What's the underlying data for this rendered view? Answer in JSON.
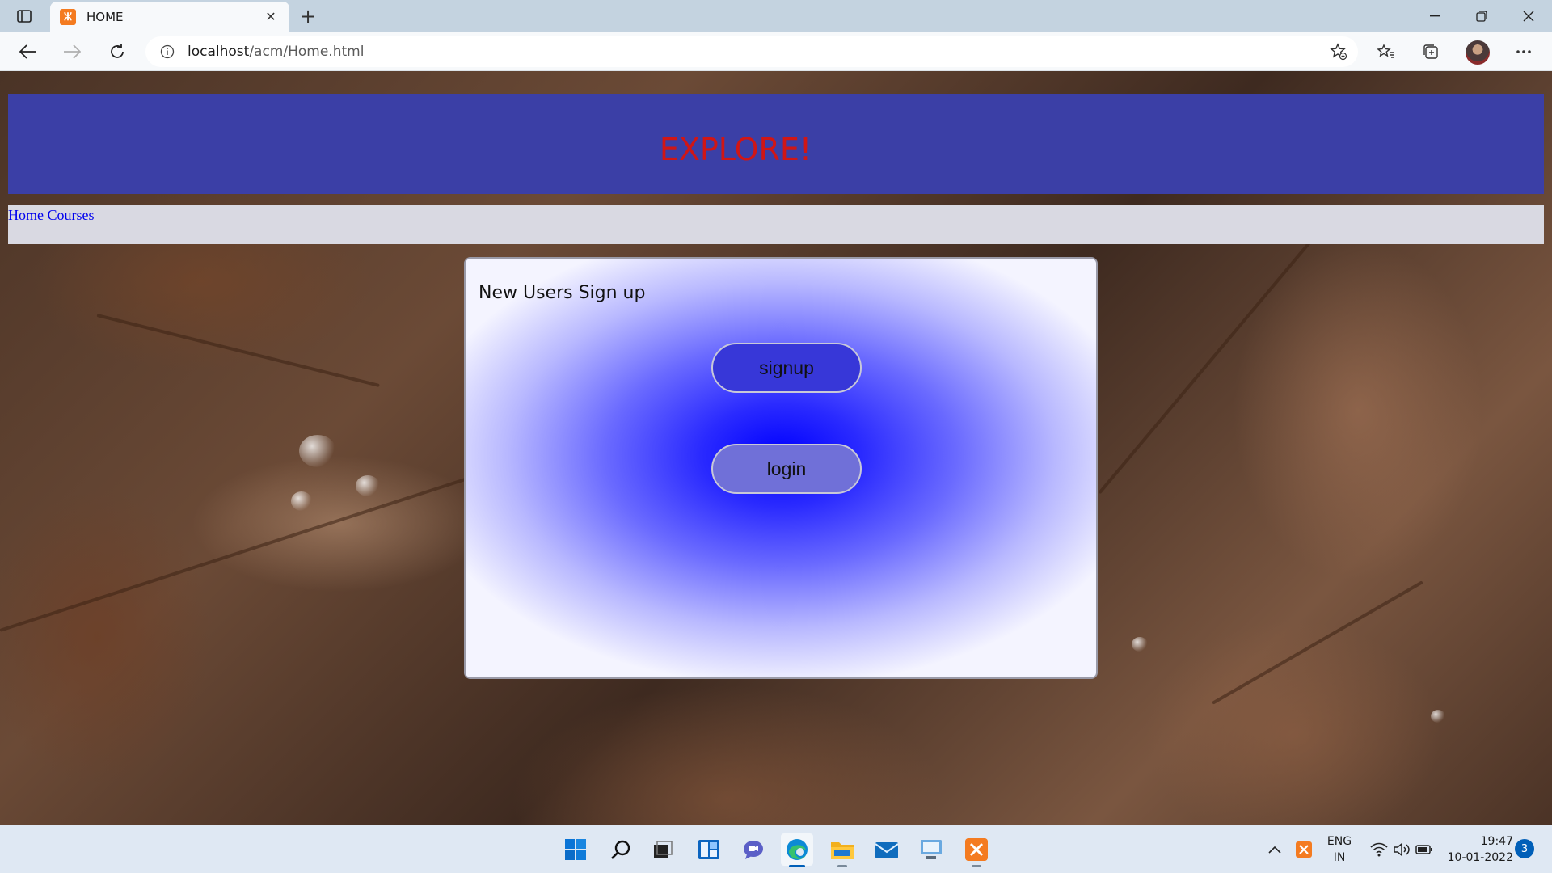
{
  "browser": {
    "tab_title": "HOME",
    "url_host": "localhost",
    "url_path": "/acm/Home.html"
  },
  "page": {
    "banner_title": "EXPLORE!",
    "nav": [
      {
        "label": "Home"
      },
      {
        "label": "Courses"
      }
    ],
    "card": {
      "heading": "New Users Sign up",
      "signup_label": "signup",
      "login_label": "login"
    }
  },
  "taskbar": {
    "language": "ENG",
    "region": "IN",
    "time": "19:47",
    "date": "10-01-2022",
    "notifications": "3",
    "apps": [
      "start-icon",
      "search-icon",
      "task-view-icon",
      "widgets-icon",
      "chat-icon",
      "edge-icon",
      "file-explorer-icon",
      "mail-icon",
      "remote-desktop-icon",
      "xampp-icon"
    ]
  },
  "colors": {
    "banner_bg": "#3b3fa6",
    "banner_text": "#d01616",
    "navbar_bg": "#d9d9e2",
    "signup_button": "#3737d8",
    "login_button": "#7070d8",
    "card_gradient_center": "#0000ff"
  }
}
